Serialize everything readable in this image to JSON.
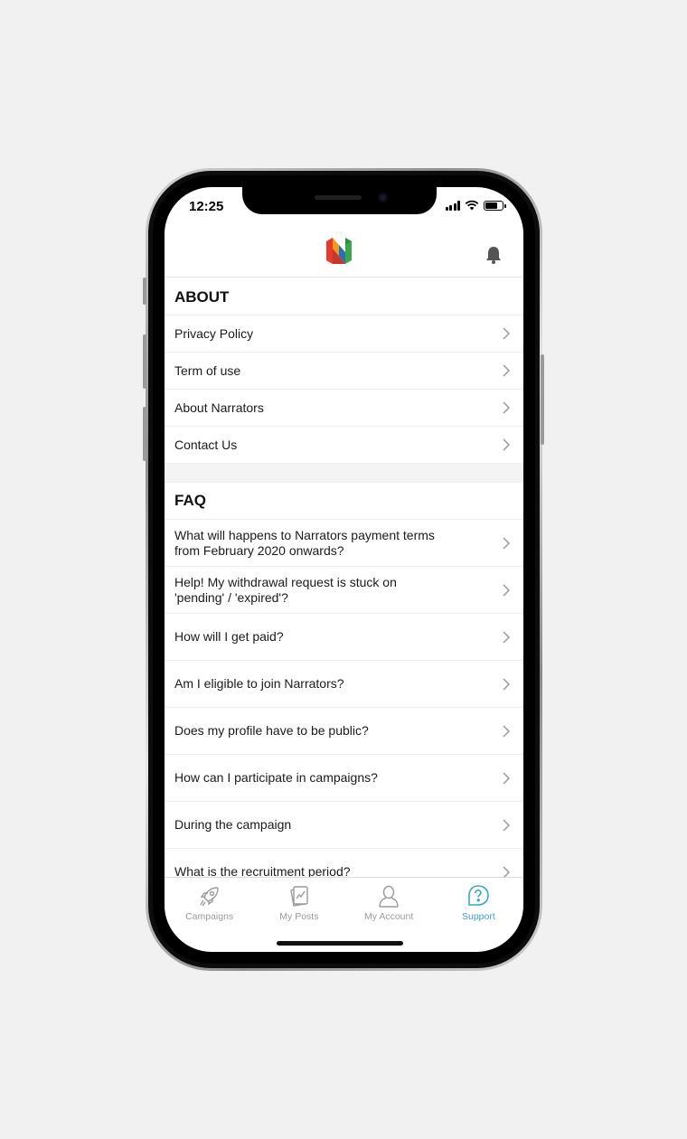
{
  "status": {
    "time": "12:25"
  },
  "header": {
    "logo_icon": "narrators-logo",
    "notification_icon": "bell-icon"
  },
  "about": {
    "title": "ABOUT",
    "items": [
      {
        "label": "Privacy Policy"
      },
      {
        "label": "Term of use"
      },
      {
        "label": "About Narrators"
      },
      {
        "label": "Contact Us"
      }
    ]
  },
  "faq": {
    "title": "FAQ",
    "items": [
      {
        "line1": "What will happens to Narrators payment terms",
        "line2": "from February 2020 onwards?"
      },
      {
        "line1": "Help! My withdrawal request is stuck on",
        "line2": "'pending' / 'expired'?"
      },
      {
        "line1": "How will I get paid?",
        "line2": ""
      },
      {
        "line1": "Am I eligible to join Narrators?",
        "line2": ""
      },
      {
        "line1": "Does my profile have to be public?",
        "line2": ""
      },
      {
        "line1": "How can I participate in campaigns?",
        "line2": ""
      },
      {
        "line1": "During the campaign",
        "line2": ""
      },
      {
        "line1": "What is the recruitment period?",
        "line2": ""
      }
    ]
  },
  "tabs": [
    {
      "label": "Campaigns",
      "icon": "rocket-icon"
    },
    {
      "label": "My Posts",
      "icon": "posts-icon"
    },
    {
      "label": "My Account",
      "icon": "user-icon"
    },
    {
      "label": "Support",
      "icon": "support-icon",
      "active": true
    }
  ],
  "colors": {
    "accent": "#3aa3cf",
    "inactive": "#9a9a9a",
    "logo_red": "#e53a2f",
    "logo_orange": "#f29a1f",
    "logo_blue": "#2a6fb5",
    "logo_green": "#3ea64a"
  }
}
